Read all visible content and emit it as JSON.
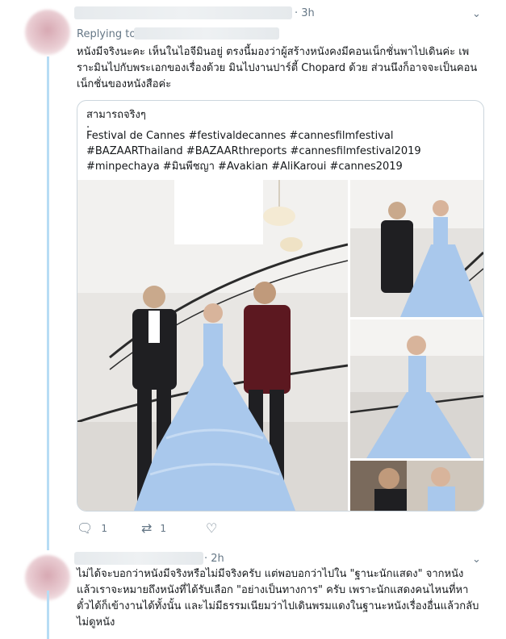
{
  "tweet1": {
    "time": "· 3h",
    "replying_label": "Replying to",
    "lines": [
      "หนังมีจริงนะคะ เห็นในไอจีมินอยู่ ตรงนี้มองว่าผู้สร้างหนังคงมีคอนเน็กชั่นพาไปเดินค่ะ เพ",
      "ราะมินไปกับพระเอกของเรื่องด้วย มินไปงานปาร์ตี้ Chopard ด้วย ส่วนนึงก็อาจจะเป็นคอน",
      "เน็กชั่นของหนังสือค่ะ"
    ],
    "card": {
      "title": "สามารถจริงๆ",
      "dot": ".",
      "caption_lines": [
        "Festival de Cannes #festivaldecannes #cannesfilmfestival",
        "#BAZAARThailand #BAZAARthreports #cannesfilmfestival2019",
        "#minpechaya #มินพีชญา #Avakian #AliKaroui #cannes2019"
      ]
    },
    "actions": {
      "reply_count": "1",
      "retweet_count": "1",
      "like_count": ""
    }
  },
  "tweet2": {
    "time": "· 2h",
    "lines": [
      "ไม่ได้จะบอกว่าหนังมีจริงหรือไม่มีจริงครับ แต่พอบอกว่าไปใน \"ฐานะนักแสดง\" จากหนัง",
      "แล้วเราจะหมายถึงหนังที่ได้รับเลือก \"อย่างเป็นทางการ\" ครับ เพราะนักแสดงคนไหนที่หา",
      "ตั๋วได้ก็เข้างานได้ทั้งนั้น และไม่มีธรรมเนียมว่าไปเดินพรมแดงในฐานะหนังเรื่องอื่นแล้วกลับ",
      "ไม่ดูหนัง"
    ]
  },
  "icons": {
    "reply": "reply-icon",
    "retweet": "retweet-icon",
    "like": "heart-icon",
    "chevron": "chevron-down-icon"
  },
  "colors": {
    "thread_line": "#b7dcf4",
    "muted_text": "#657786",
    "gown_blue": "#a9c8ec"
  }
}
